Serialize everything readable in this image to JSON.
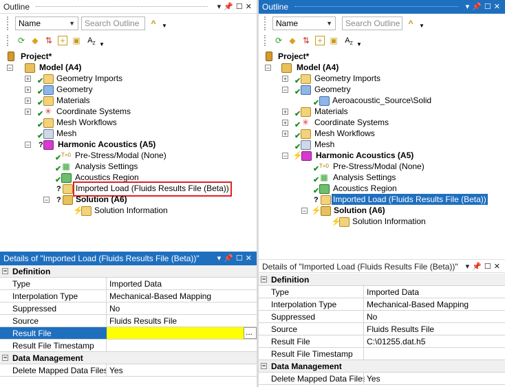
{
  "left": {
    "outline_title": "Outline",
    "name_combo": "Name",
    "search_placeholder": "Search Outline",
    "tree": {
      "project": "Project*",
      "model": "Model (A4)",
      "geometry_imports": "Geometry Imports",
      "geometry": "Geometry",
      "materials": "Materials",
      "coordinate_systems": "Coordinate Systems",
      "mesh_workflows": "Mesh Workflows",
      "mesh": "Mesh",
      "harmonic": "Harmonic Acoustics (A5)",
      "prestress": "Pre-Stress/Modal (None)",
      "analysis_settings": "Analysis Settings",
      "acoustics_region": "Acoustics Region",
      "imported_load": "Imported Load (Fluids Results File (Beta))",
      "solution": "Solution (A6)",
      "solution_info": "Solution Information"
    },
    "details_title": "Details of \"Imported Load (Fluids Results File (Beta))\" ",
    "details": {
      "cat_definition": "Definition",
      "type_label": "Type",
      "type_value": "Imported Data",
      "interp_label": "Interpolation Type",
      "interp_value": "Mechanical-Based Mapping",
      "suppressed_label": "Suppressed",
      "suppressed_value": "No",
      "source_label": "Source",
      "source_value": "Fluids Results File",
      "result_file_label": "Result File",
      "result_file_value": "",
      "browse_label": "...",
      "timestamp_label": "Result File Timestamp",
      "timestamp_value": "",
      "cat_data_mgmt": "Data Management",
      "delete_label": "Delete Mapped Data Files",
      "delete_value": "Yes"
    }
  },
  "right": {
    "outline_title": "Outline",
    "name_combo": "Name",
    "search_placeholder": "Search Outline",
    "tree": {
      "project": "Project*",
      "model": "Model (A4)",
      "geometry_imports": "Geometry Imports",
      "geometry": "Geometry",
      "aero_solid": "Aeroacoustic_Source\\Solid",
      "materials": "Materials",
      "coordinate_systems": "Coordinate Systems",
      "mesh_workflows": "Mesh Workflows",
      "mesh": "Mesh",
      "harmonic": "Harmonic Acoustics (A5)",
      "prestress": "Pre-Stress/Modal (None)",
      "analysis_settings": "Analysis Settings",
      "acoustics_region": "Acoustics Region",
      "imported_load": "Imported Load (Fluids Results File (Beta))",
      "solution": "Solution (A6)",
      "solution_info": "Solution Information"
    },
    "details_title": "Details of \"Imported Load (Fluids Results File (Beta))\" ",
    "details": {
      "cat_definition": "Definition",
      "type_label": "Type",
      "type_value": "Imported Data",
      "interp_label": "Interpolation Type",
      "interp_value": "Mechanical-Based Mapping",
      "suppressed_label": "Suppressed",
      "suppressed_value": "No",
      "source_label": "Source",
      "source_value": "Fluids Results File",
      "result_file_label": "Result File",
      "result_file_value": "C:\\01255.dat.h5",
      "timestamp_label": "Result File Timestamp",
      "timestamp_value": "",
      "cat_data_mgmt": "Data Management",
      "delete_label": "Delete Mapped Data Files",
      "delete_value": "Yes"
    }
  },
  "colors": {
    "active_title": "#1f6fbf",
    "selection": "#1f6fbf",
    "highlight_box": "#e02020",
    "result_file_empty": "#ffff00",
    "check_green": "#1d8f1d"
  },
  "icons": [
    "refresh-icon",
    "eraser-icon",
    "sort-icon",
    "add-icon",
    "filter-folder-icon",
    "sort-az-icon",
    "pin-icon",
    "maximize-icon",
    "close-icon",
    "chevron-down-icon"
  ]
}
